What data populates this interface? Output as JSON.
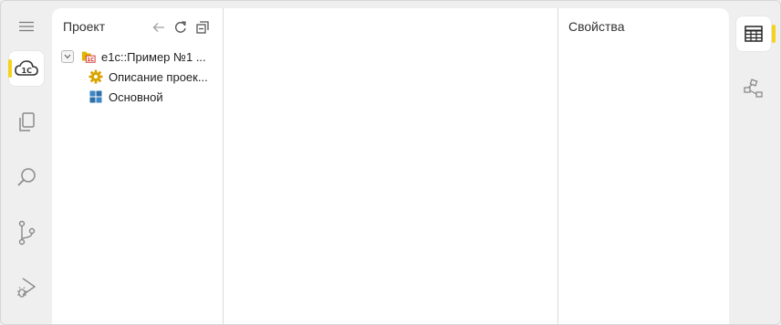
{
  "project_panel": {
    "title": "Проект",
    "tools": [
      "back-arrow-icon",
      "refresh-icon",
      "collapse-all-icon"
    ]
  },
  "tree": {
    "root": {
      "label": "e1c::Пример №1 ...",
      "icon": "project-folder-1c-icon",
      "expanded": true
    },
    "children": [
      {
        "label": "Описание проек...",
        "icon": "gear-icon"
      },
      {
        "label": "Основной",
        "icon": "grid-subsystem-icon"
      }
    ]
  },
  "properties_panel": {
    "title": "Свойства"
  },
  "activity_bar": {
    "items": [
      "menu-icon",
      "cloud-1c-icon",
      "copy-icon",
      "search-icon",
      "branch-icon",
      "run-debug-icon"
    ],
    "active": "cloud-1c-icon"
  },
  "right_bar": {
    "items": [
      "table-icon",
      "structure-icon"
    ],
    "active": "table-icon"
  },
  "colors": {
    "accent": "#f5d21d",
    "background": "#efefef",
    "panel": "#ffffff"
  }
}
